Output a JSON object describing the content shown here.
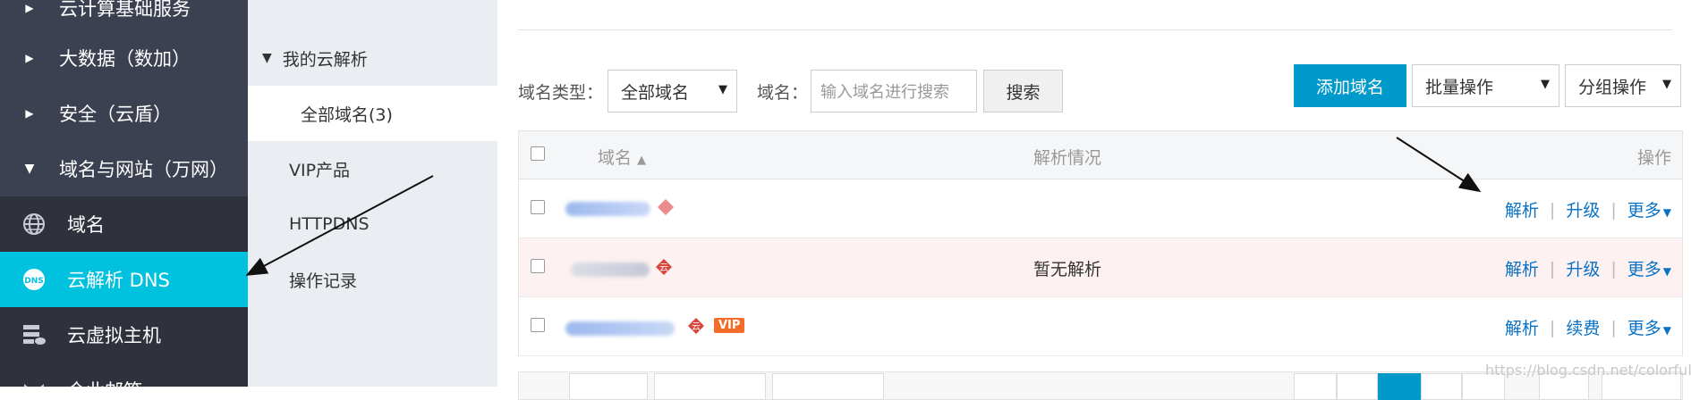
{
  "sidebar": {
    "groups": [
      {
        "label": "云计算基础服务",
        "expanded": false
      },
      {
        "label": "大数据（数加）",
        "expanded": false
      },
      {
        "label": "安全（云盾）",
        "expanded": false
      },
      {
        "label": "域名与网站（万网）",
        "expanded": true
      }
    ],
    "subitems": [
      {
        "label": "域名",
        "icon": "globe-icon",
        "active": false
      },
      {
        "label": "云解析 DNS",
        "icon": "dns-icon",
        "active": true
      },
      {
        "label": "云虚拟主机",
        "icon": "server-icon",
        "active": false
      },
      {
        "label": "企业邮箱",
        "icon": "mail-icon",
        "active": false
      }
    ]
  },
  "subnav": {
    "group_label": "我的云解析",
    "items": [
      {
        "label": "全部域名(3)",
        "active": true
      },
      {
        "label": "VIP产品"
      },
      {
        "label": "HTTPDNS"
      },
      {
        "label": "操作记录"
      }
    ]
  },
  "toolbar": {
    "domain_type_label": "域名类型：",
    "domain_type_value": "全部域名",
    "domain_label": "域名：",
    "search_placeholder": "输入域名进行搜索",
    "search_button": "搜索",
    "add_domain_button": "添加域名",
    "batch_ops": "批量操作",
    "group_ops": "分组操作"
  },
  "table": {
    "columns": {
      "domain": "域名",
      "status": "解析情况",
      "ops": "操作"
    },
    "rows": [
      {
        "status": "",
        "actions": [
          "解析",
          "升级",
          "更多"
        ],
        "vip": false
      },
      {
        "status": "暂无解析",
        "actions": [
          "解析",
          "升级",
          "更多"
        ],
        "vip": true
      },
      {
        "status": "",
        "actions": [
          "解析",
          "续费",
          "更多"
        ],
        "vip": false,
        "badge": "VIP"
      }
    ]
  },
  "watermark": "https://blog.csdn.net/colorfulyan",
  "colors": {
    "sidebar_bg": "#3c4151",
    "sidebar_active": "#00c1de",
    "primary": "#0099cc",
    "link": "#0a72c4",
    "vip": "#f36c2a"
  }
}
